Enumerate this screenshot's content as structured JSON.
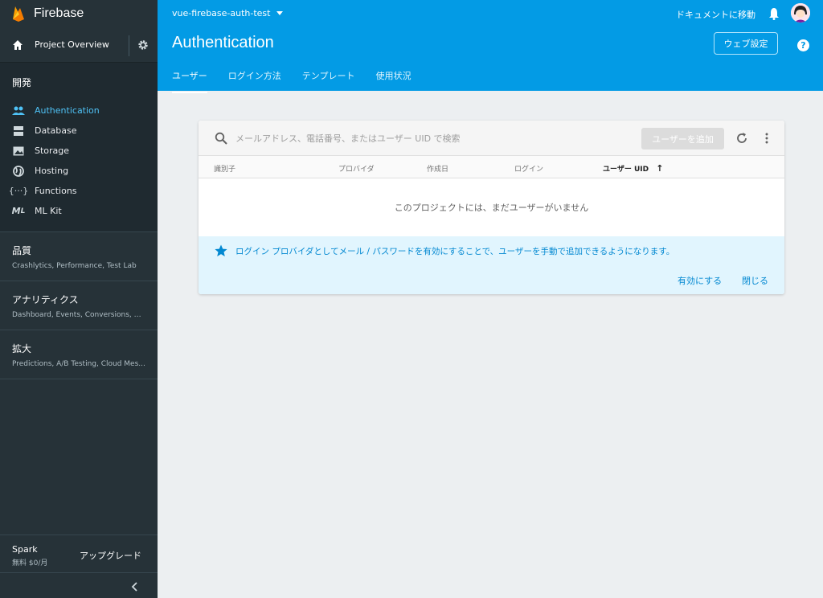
{
  "sidebar": {
    "brand": "Firebase",
    "overview": "Project Overview",
    "dev_section": "開発",
    "dev_items": [
      {
        "label": "Authentication"
      },
      {
        "label": "Database"
      },
      {
        "label": "Storage"
      },
      {
        "label": "Hosting"
      },
      {
        "label": "Functions"
      },
      {
        "label": "ML Kit"
      }
    ],
    "groups": [
      {
        "title": "品質",
        "subtitle": "Crashlytics, Performance, Test Lab"
      },
      {
        "title": "アナリティクス",
        "subtitle": "Dashboard, Events, Conversions, Au..."
      },
      {
        "title": "拡大",
        "subtitle": "Predictions, A/B Testing, Cloud Mes..."
      }
    ],
    "plan": {
      "name": "Spark",
      "price": "無料 $0/月",
      "upgrade": "アップグレード"
    }
  },
  "header": {
    "project": "vue-firebase-auth-test",
    "docs": "ドキュメントに移動",
    "title": "Authentication",
    "web_setting": "ウェブ設定",
    "help": "?",
    "tabs": [
      {
        "label": "ユーザー"
      },
      {
        "label": "ログイン方法"
      },
      {
        "label": "テンプレート"
      },
      {
        "label": "使用状況"
      }
    ]
  },
  "card": {
    "search_placeholder": "メールアドレス、電話番号、またはユーザー UID で検索",
    "add_user": "ユーザーを追加",
    "columns": [
      "識別子",
      "プロバイダ",
      "作成日",
      "ログイン",
      "ユーザー UID"
    ],
    "sort_arrow": "↑",
    "empty": "このプロジェクトには、まだユーザーがいません",
    "banner_message": "ログイン プロバイダとしてメール / パスワードを有効にすることで、ユーザーを手動で追加できるようになります。",
    "enable": "有効にする",
    "close": "閉じる"
  },
  "colors": {
    "header": "#039be5",
    "sidebar": "#263238",
    "active": "#4fc3f7",
    "banner": "#e1f5fe"
  }
}
